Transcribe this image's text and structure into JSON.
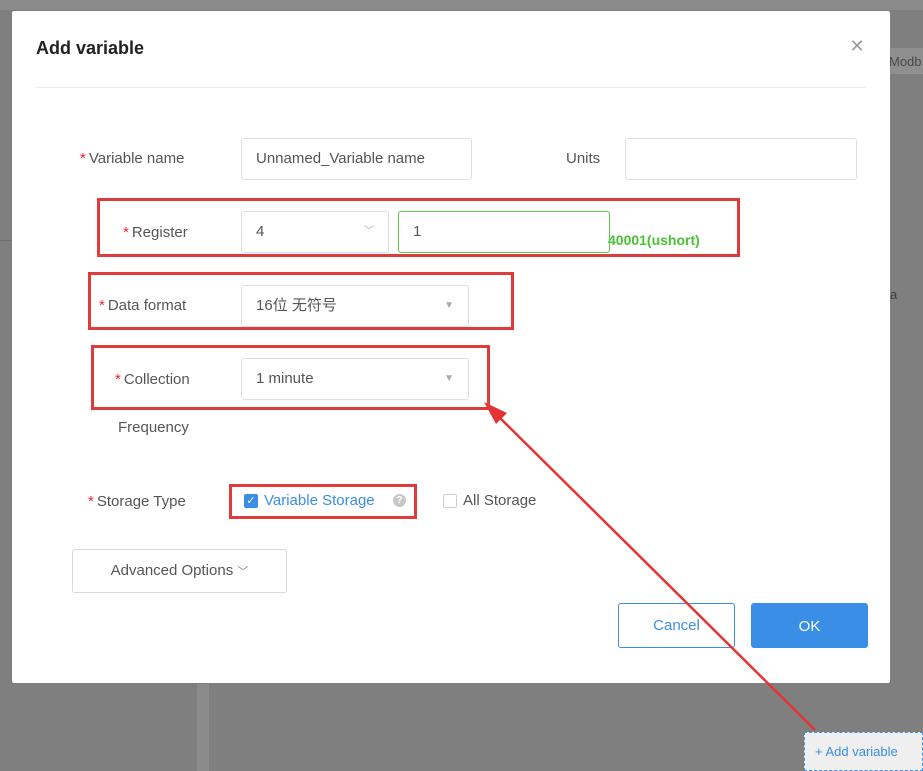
{
  "background": {
    "side_tab_text": "Modb",
    "side_fragment": "a",
    "add_variable_button": "+ Add variable"
  },
  "dialog": {
    "title": "Add variable",
    "close_icon": "close-icon",
    "fields": {
      "variable_name": {
        "label": "Variable name",
        "value": "Unnamed_Variable name",
        "required": true
      },
      "units": {
        "label": "Units",
        "value": "",
        "required": false
      },
      "register": {
        "label": "Register",
        "type_value": "4",
        "address_value": "1",
        "info": "40001(ushort)",
        "required": true
      },
      "data_format": {
        "label": "Data format",
        "value": "16位 无符号",
        "required": true
      },
      "collection_frequency": {
        "label_line1": "Collection",
        "label_line2": "Frequency",
        "value": "1 minute",
        "required": true
      },
      "storage_type": {
        "label": "Storage Type",
        "required": true,
        "options": [
          {
            "label": "Variable Storage",
            "checked": true
          },
          {
            "label": "All Storage",
            "checked": false
          }
        ]
      }
    },
    "advanced_options_label": "Advanced Options",
    "buttons": {
      "cancel": "Cancel",
      "ok": "OK"
    }
  },
  "colors": {
    "highlight_red": "#e03b3b",
    "primary_blue": "#3a8ee6",
    "success_green": "#49c233",
    "required_red": "#f5222d"
  }
}
